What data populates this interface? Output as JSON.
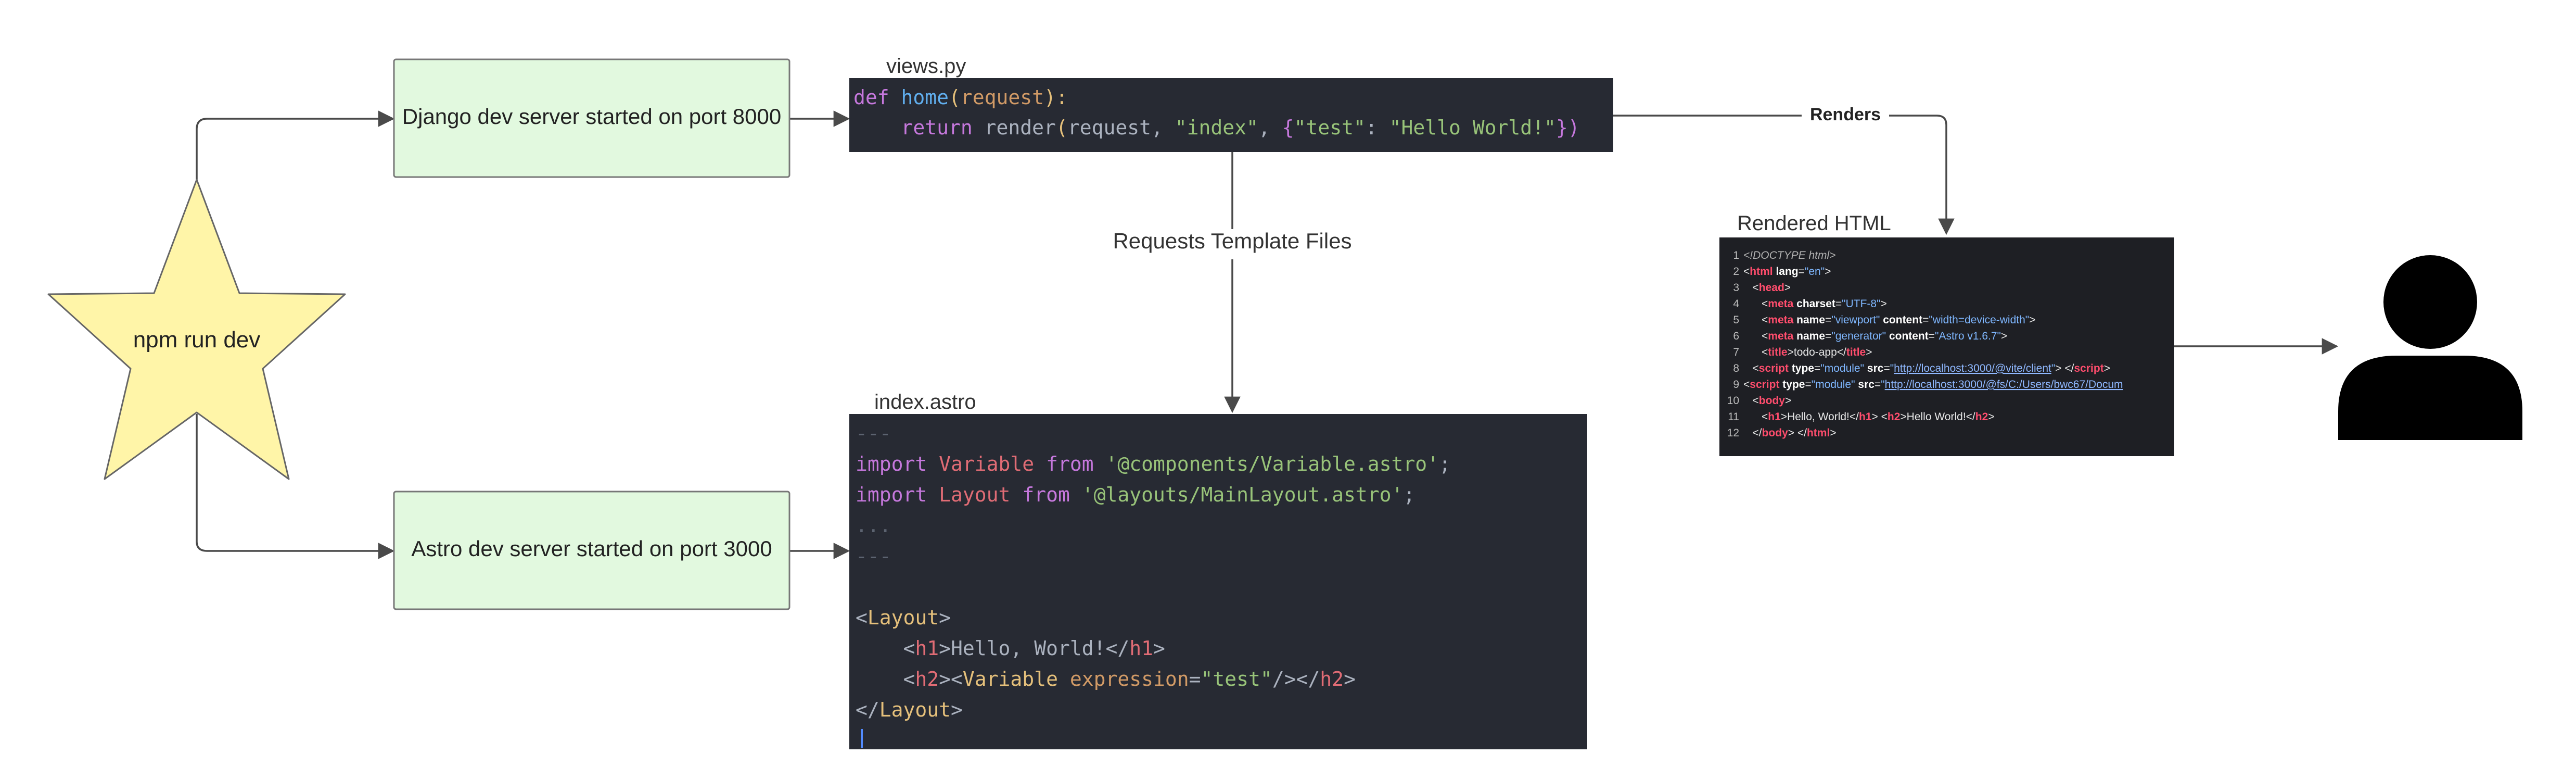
{
  "nodes": {
    "start": {
      "label": "npm run dev",
      "fill": "#fff5a8",
      "stroke": "#666666"
    },
    "django": {
      "label": "Django dev server started on port 8000",
      "fill": "#e2f9df",
      "stroke": "#777777"
    },
    "astro": {
      "label": "Astro dev server started on port 3000",
      "fill": "#e2f9df",
      "stroke": "#777777"
    }
  },
  "edges": {
    "requests": "Requests Template Files",
    "renders": "Renders"
  },
  "views": {
    "title": "views.py",
    "lines": [
      [
        {
          "t": "def ",
          "c": "kw"
        },
        {
          "t": "home",
          "c": "fn"
        },
        {
          "t": "(",
          "c": "paren"
        },
        {
          "t": "request",
          "c": "param"
        },
        {
          "t": "):",
          "c": "paren"
        }
      ],
      [
        {
          "t": "    return ",
          "c": "kw"
        },
        {
          "t": "render",
          "c": "plain"
        },
        {
          "t": "(",
          "c": "paren"
        },
        {
          "t": "request, ",
          "c": "plain"
        },
        {
          "t": "\"index\"",
          "c": "str"
        },
        {
          "t": ", ",
          "c": "plain"
        },
        {
          "t": "{",
          "c": "brace"
        },
        {
          "t": "\"test\"",
          "c": "str"
        },
        {
          "t": ": ",
          "c": "plain"
        },
        {
          "t": "\"Hello World!\"",
          "c": "str"
        },
        {
          "t": "})",
          "c": "brace"
        }
      ]
    ]
  },
  "astro_file": {
    "title": "index.astro",
    "lines": [
      [
        {
          "t": "---",
          "c": "comment"
        }
      ],
      [
        {
          "t": "import ",
          "c": "kw"
        },
        {
          "t": "Variable ",
          "c": "var"
        },
        {
          "t": "from ",
          "c": "kw"
        },
        {
          "t": "'@components/Variable.astro'",
          "c": "str"
        },
        {
          "t": ";",
          "c": "plain"
        }
      ],
      [
        {
          "t": "import ",
          "c": "kw"
        },
        {
          "t": "Layout ",
          "c": "var"
        },
        {
          "t": "from ",
          "c": "kw"
        },
        {
          "t": "'@layouts/MainLayout.astro'",
          "c": "str"
        },
        {
          "t": ";",
          "c": "plain"
        }
      ],
      [
        {
          "t": "...",
          "c": "comment"
        }
      ],
      [
        {
          "t": "---",
          "c": "comment"
        }
      ],
      [],
      [
        {
          "t": "<",
          "c": "angle"
        },
        {
          "t": "Layout",
          "c": "comp"
        },
        {
          "t": ">",
          "c": "angle"
        }
      ],
      [
        {
          "t": "    <",
          "c": "angle"
        },
        {
          "t": "h1",
          "c": "tag"
        },
        {
          "t": ">",
          "c": "angle"
        },
        {
          "t": "Hello, World!",
          "c": "plain"
        },
        {
          "t": "</",
          "c": "angle"
        },
        {
          "t": "h1",
          "c": "tag"
        },
        {
          "t": ">",
          "c": "angle"
        }
      ],
      [
        {
          "t": "    <",
          "c": "angle"
        },
        {
          "t": "h2",
          "c": "tag"
        },
        {
          "t": "><",
          "c": "angle"
        },
        {
          "t": "Variable ",
          "c": "comp"
        },
        {
          "t": "expression",
          "c": "attr"
        },
        {
          "t": "=",
          "c": "plain"
        },
        {
          "t": "\"test\"",
          "c": "str"
        },
        {
          "t": "/></",
          "c": "angle"
        },
        {
          "t": "h2",
          "c": "tag"
        },
        {
          "t": ">",
          "c": "angle"
        }
      ],
      [
        {
          "t": "</",
          "c": "angle"
        },
        {
          "t": "Layout",
          "c": "comp"
        },
        {
          "t": ">",
          "c": "angle"
        }
      ]
    ]
  },
  "rendered": {
    "title": "Rendered HTML",
    "lines": [
      [
        {
          "t": "<!DOCTYPE html>",
          "c": "doctype"
        }
      ],
      [
        {
          "t": "<",
          "c": "w"
        },
        {
          "t": "html",
          "c": "tag"
        },
        {
          "t": " ",
          "c": "w"
        },
        {
          "t": "lang",
          "c": "attr"
        },
        {
          "t": "=",
          "c": "w"
        },
        {
          "t": "\"en\"",
          "c": "val"
        },
        {
          "t": ">",
          "c": "w"
        }
      ],
      [
        {
          "t": "   <",
          "c": "w"
        },
        {
          "t": "head",
          "c": "tag"
        },
        {
          "t": ">",
          "c": "w"
        }
      ],
      [
        {
          "t": "      <",
          "c": "w"
        },
        {
          "t": "meta",
          "c": "tag"
        },
        {
          "t": " ",
          "c": "w"
        },
        {
          "t": "charset",
          "c": "attr"
        },
        {
          "t": "=",
          "c": "w"
        },
        {
          "t": "\"UTF-8\"",
          "c": "val"
        },
        {
          "t": ">",
          "c": "w"
        }
      ],
      [
        {
          "t": "      <",
          "c": "w"
        },
        {
          "t": "meta",
          "c": "tag"
        },
        {
          "t": " ",
          "c": "w"
        },
        {
          "t": "name",
          "c": "attr"
        },
        {
          "t": "=",
          "c": "w"
        },
        {
          "t": "\"viewport\"",
          "c": "val"
        },
        {
          "t": " ",
          "c": "w"
        },
        {
          "t": "content",
          "c": "attr"
        },
        {
          "t": "=",
          "c": "w"
        },
        {
          "t": "\"width=device-width\"",
          "c": "val"
        },
        {
          "t": ">",
          "c": "w"
        }
      ],
      [
        {
          "t": "      <",
          "c": "w"
        },
        {
          "t": "meta",
          "c": "tag"
        },
        {
          "t": " ",
          "c": "w"
        },
        {
          "t": "name",
          "c": "attr"
        },
        {
          "t": "=",
          "c": "w"
        },
        {
          "t": "\"generator\"",
          "c": "val"
        },
        {
          "t": " ",
          "c": "w"
        },
        {
          "t": "content",
          "c": "attr"
        },
        {
          "t": "=",
          "c": "w"
        },
        {
          "t": "\"Astro v1.6.7\"",
          "c": "val"
        },
        {
          "t": ">",
          "c": "w"
        }
      ],
      [
        {
          "t": "      <",
          "c": "w"
        },
        {
          "t": "title",
          "c": "tag"
        },
        {
          "t": ">",
          "c": "w"
        },
        {
          "t": "todo-app",
          "c": "w"
        },
        {
          "t": "</",
          "c": "w"
        },
        {
          "t": "title",
          "c": "tag"
        },
        {
          "t": ">",
          "c": "w"
        }
      ],
      [
        {
          "t": "   <",
          "c": "w"
        },
        {
          "t": "script",
          "c": "tag"
        },
        {
          "t": " ",
          "c": "w"
        },
        {
          "t": "type",
          "c": "attr"
        },
        {
          "t": "=",
          "c": "w"
        },
        {
          "t": "\"module\"",
          "c": "val"
        },
        {
          "t": " ",
          "c": "w"
        },
        {
          "t": "src",
          "c": "attr"
        },
        {
          "t": "=",
          "c": "w"
        },
        {
          "t": "\"",
          "c": "val"
        },
        {
          "t": "http://localhost:3000/@vite/client",
          "c": "link"
        },
        {
          "t": "\"",
          "c": "val"
        },
        {
          "t": "> </",
          "c": "w"
        },
        {
          "t": "script",
          "c": "tag"
        },
        {
          "t": ">",
          "c": "w"
        }
      ],
      [
        {
          "t": "<",
          "c": "w"
        },
        {
          "t": "script",
          "c": "tag"
        },
        {
          "t": " ",
          "c": "w"
        },
        {
          "t": "type",
          "c": "attr"
        },
        {
          "t": "=",
          "c": "w"
        },
        {
          "t": "\"module\"",
          "c": "val"
        },
        {
          "t": " ",
          "c": "w"
        },
        {
          "t": "src",
          "c": "attr"
        },
        {
          "t": "=",
          "c": "w"
        },
        {
          "t": "\"",
          "c": "val"
        },
        {
          "t": "http://localhost:3000/@fs/C:/Users/bwc67/Docum",
          "c": "link"
        }
      ],
      [
        {
          "t": "   <",
          "c": "w"
        },
        {
          "t": "body",
          "c": "tag"
        },
        {
          "t": ">",
          "c": "w"
        }
      ],
      [
        {
          "t": "      <",
          "c": "w"
        },
        {
          "t": "h1",
          "c": "tag"
        },
        {
          "t": ">",
          "c": "w"
        },
        {
          "t": "Hello, World!",
          "c": "w"
        },
        {
          "t": "</",
          "c": "w"
        },
        {
          "t": "h1",
          "c": "tag"
        },
        {
          "t": "> <",
          "c": "w"
        },
        {
          "t": "h2",
          "c": "tag"
        },
        {
          "t": ">",
          "c": "w"
        },
        {
          "t": "Hello World!",
          "c": "w"
        },
        {
          "t": "</",
          "c": "w"
        },
        {
          "t": "h2",
          "c": "tag"
        },
        {
          "t": ">",
          "c": "w"
        }
      ],
      [
        {
          "t": "   </",
          "c": "w"
        },
        {
          "t": "body",
          "c": "tag"
        },
        {
          "t": "> </",
          "c": "w"
        },
        {
          "t": "html",
          "c": "tag"
        },
        {
          "t": ">",
          "c": "w"
        }
      ]
    ]
  },
  "user": {
    "icon": "user-icon"
  },
  "colors": {
    "code_bg_dark": "#272a33",
    "rendered_bg": "#1e1f24",
    "edge": "#4a4a4a",
    "kw": "#c678dd",
    "fn": "#61afef",
    "paren": "#e5c07b",
    "param": "#d19a66",
    "str": "#98c379",
    "brace": "#c678dd",
    "plain": "#abb2bf",
    "comment": "#5c6370",
    "var": "#e06c75",
    "comp": "#e5c07b",
    "tag": "#e06c75",
    "attr": "#d19a66",
    "angle": "#abb2bf",
    "r_tag": "#ff4d6d",
    "r_attr": "#ffffff",
    "r_val": "#7fb7ff",
    "r_link": "#8fb8ff",
    "r_text": "#e8e8e8",
    "r_doctype": "#b0b0b0",
    "r_linenum": "#bfbfbf"
  }
}
